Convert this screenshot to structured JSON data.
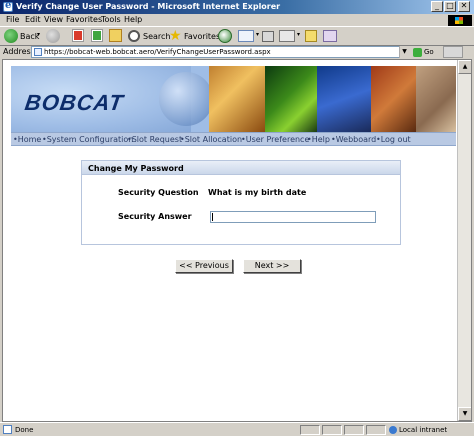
{
  "window": {
    "title": "Verify Change User Password - Microsoft Internet Explorer",
    "controls": [
      "_",
      "□",
      "✕"
    ]
  },
  "menu": [
    "File",
    "Edit",
    "View",
    "Favorites",
    "Tools",
    "Help"
  ],
  "toolbar": {
    "back_label": "Back",
    "search_label": "Search",
    "favorites_label": "Favorites"
  },
  "address": {
    "label": "Address",
    "url": "https://bobcat-web.bobcat.aero/VerifyChangeUserPassword.aspx",
    "go_label": "Go"
  },
  "banner": {
    "logo": "BOBCAT"
  },
  "nav": [
    "•Home",
    "•System Configuration",
    "•Slot Request",
    "•Slot Allocation",
    "•User Preference",
    "•Help",
    "•Webboard",
    "•Log out"
  ],
  "form": {
    "header": "Change My Password",
    "question_label": "Security Question",
    "question_value": "What is my birth date",
    "answer_label": "Security Answer",
    "answer_value": ""
  },
  "buttons": {
    "previous": "<< Previous",
    "next": "Next >>"
  },
  "status": {
    "text": "Done",
    "zone": "Local intranet"
  },
  "colors": {
    "title_bar": "#0a246a",
    "nav_bar": "#b9c9e3",
    "panel_header": "#cbd7ea",
    "logo": "#0d2d6b"
  }
}
